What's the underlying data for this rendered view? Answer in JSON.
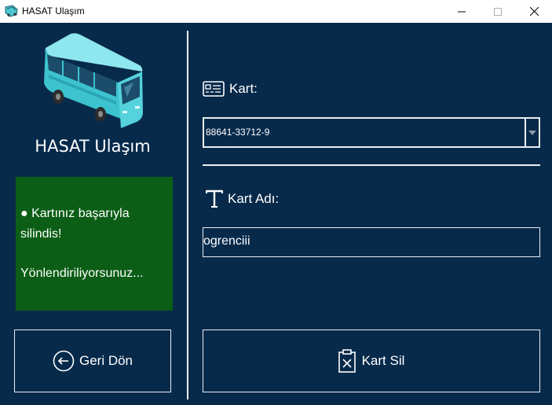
{
  "window": {
    "title": "HASAT Ulaşım"
  },
  "sidebar": {
    "brand": "HASAT Ulaşım",
    "status": {
      "line1": "● Kartınız başarıyla silindis!",
      "line2": "Yönlendiriliyorsunuz..."
    },
    "back_button_label": "Geri Dön"
  },
  "form": {
    "kart_label": "Kart:",
    "kart_value": "88641-33712-9",
    "kart_adi_label": "Kart Adı:",
    "kart_adi_value": "ogrenciii",
    "delete_button_label": "Kart Sil"
  },
  "colors": {
    "background": "#072a4b",
    "status_bg": "#0c5e16",
    "border": "#e9eef3",
    "bus_body": "#3cc3cf"
  }
}
